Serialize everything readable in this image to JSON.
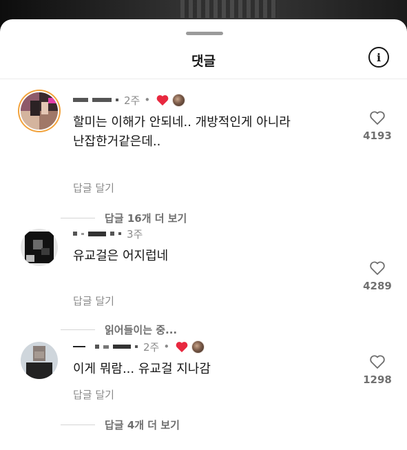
{
  "sheet": {
    "title": "댓글"
  },
  "comments": [
    {
      "time": "2주",
      "separator": "•",
      "text_line1": "할미는 이해가 안되네.. 개방적인게 아니라",
      "text_line2": "난잡한거같은데..",
      "reply": "답글 달기",
      "likes": "4193",
      "creator_liked": true,
      "more_replies": "답글 16개 더 보기"
    },
    {
      "time": "3주",
      "text_line1": "유교걸은 어지럽네",
      "reply": "답글 달기",
      "likes": "4289",
      "creator_liked": false,
      "more_replies": "읽어들이는 중..."
    },
    {
      "time": "2주",
      "separator": "•",
      "text_line1": "이게 뭐람... 유교걸 지나감",
      "reply": "답글 달기",
      "likes": "1298",
      "creator_liked": true,
      "more_replies": "답글 4개 더 보기"
    }
  ],
  "colors": {
    "heart_red": "#e8283f",
    "avatar_ring": "#f2a23b"
  }
}
